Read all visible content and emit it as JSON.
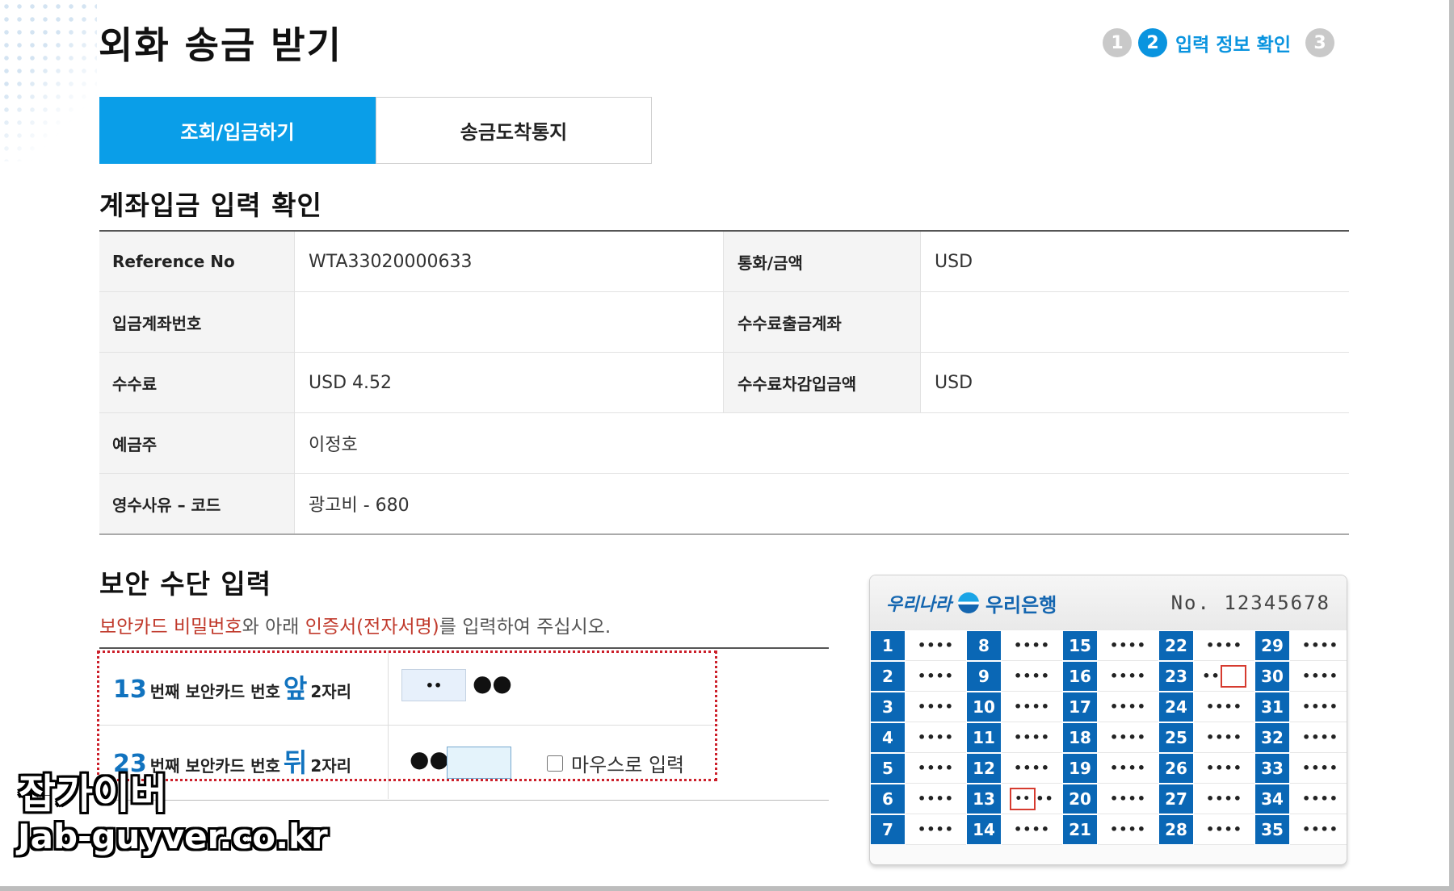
{
  "page": {
    "title": "외화 송금 받기"
  },
  "steps": [
    {
      "number": "1",
      "label": ""
    },
    {
      "number": "2",
      "label": "입력 정보 확인"
    },
    {
      "number": "3",
      "label": ""
    }
  ],
  "tabs": [
    {
      "label": "조회/입금하기",
      "active": true
    },
    {
      "label": "송금도착통지",
      "active": false
    }
  ],
  "confirm_section": {
    "title": "계좌입금 입력 확인",
    "rows": [
      {
        "label": "Reference No",
        "value": "WTA33020000633",
        "label2": "통화/금액",
        "value2": "USD"
      },
      {
        "label": "입금계좌번호",
        "value": "",
        "label2": "수수료출금계좌",
        "value2": ""
      },
      {
        "label": "수수료",
        "value": "USD 4.52",
        "label2": "수수료차감입금액",
        "value2": "USD"
      },
      {
        "label": "예금주",
        "value": "이정호"
      },
      {
        "label": "영수사유 – 코드",
        "value": "광고비 - 680"
      }
    ]
  },
  "security_section": {
    "title": "보안 수단 입력",
    "instruction": {
      "part1": "보안카드 비밀번호",
      "part2": "와 아래 ",
      "part3": "인증서(전자서명)",
      "part4": "를 입력하여 주십시오."
    },
    "row1": {
      "num": "13",
      "text_a": "번째 보안카드 번호",
      "pos": "앞",
      "text_b": "2자리",
      "input_value": "••",
      "masked": "●●"
    },
    "row2": {
      "num": "23",
      "text_a": "번째 보안카드 번호",
      "pos": "뒤",
      "text_b": "2자리",
      "masked": "●●",
      "input_value": ""
    },
    "mouse_input_label": "마우스로 입력"
  },
  "security_card": {
    "brand_script": "우리나라",
    "brand_name": "우리은행",
    "number": "No. 12345678",
    "mask": "••••",
    "mask_two": "••",
    "rows": [
      [
        "1",
        "8",
        "15",
        "22",
        "29"
      ],
      [
        "2",
        "9",
        "16",
        "23",
        "30"
      ],
      [
        "3",
        "10",
        "17",
        "24",
        "31"
      ],
      [
        "4",
        "11",
        "18",
        "25",
        "32"
      ],
      [
        "5",
        "12",
        "19",
        "26",
        "33"
      ],
      [
        "6",
        "13",
        "20",
        "27",
        "34"
      ],
      [
        "7",
        "14",
        "21",
        "28",
        "35"
      ]
    ]
  },
  "watermark": {
    "line1": "잡가이버",
    "line2": "Jab-guyver.co.kr"
  },
  "colors": {
    "accent": "#0a9ee8",
    "card_blue": "#0a67b5",
    "highlight_red": "#cc1f2a"
  }
}
